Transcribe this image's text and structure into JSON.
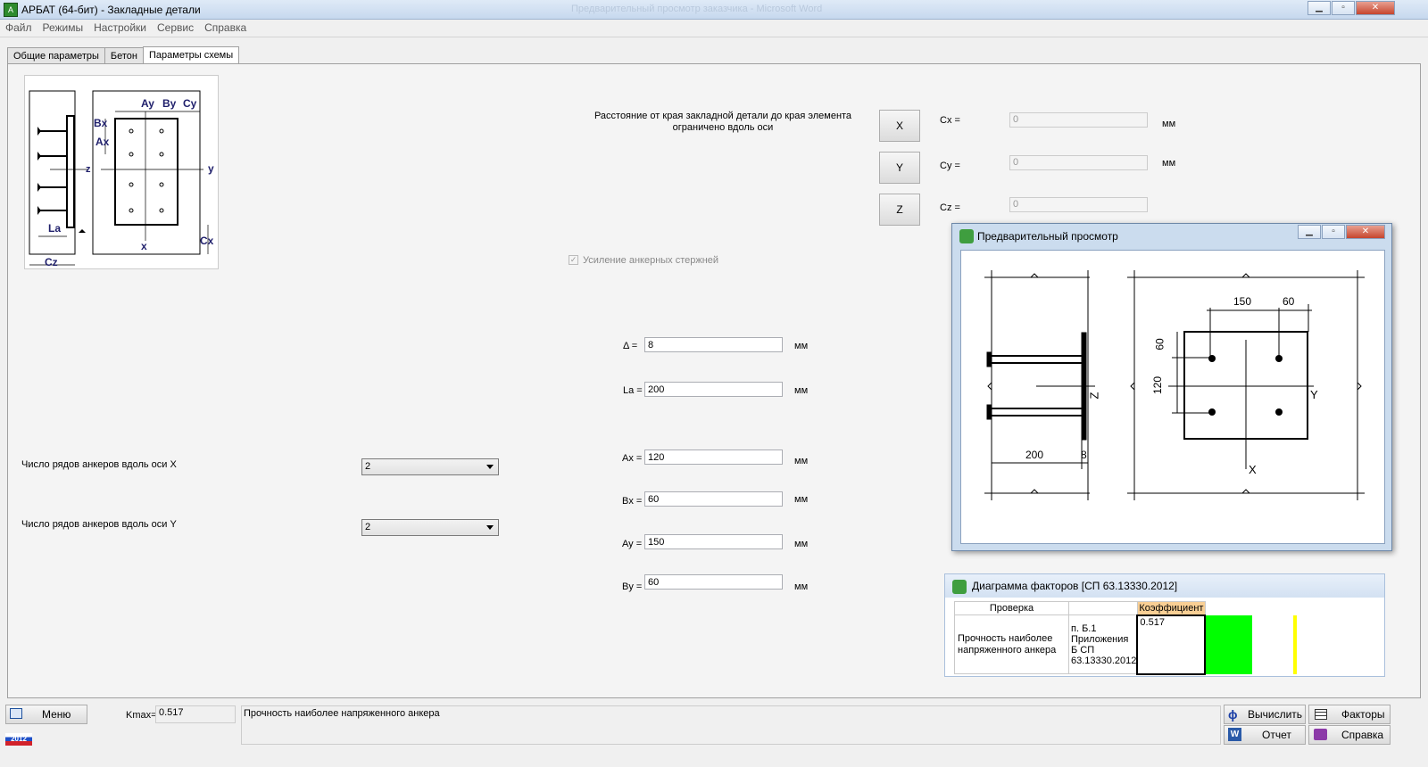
{
  "window": {
    "title": "АРБАТ (64-бит) - Закладные детали",
    "bg_title": "Предварительный просмотр заказчика - Microsoft Word"
  },
  "menu": [
    "Файл",
    "Режимы",
    "Настройки",
    "Сервис",
    "Справка"
  ],
  "tabs": [
    "Общие параметры",
    "Бетон",
    "Параметры схемы"
  ],
  "scheme_labels": {
    "ay": "Ay",
    "by": "By",
    "cy": "Cy",
    "bx": "Bx",
    "ax": "Ax",
    "y": "y",
    "z": "z",
    "x": "x",
    "la": "La",
    "cx": "Cx",
    "cz": "Cz"
  },
  "distance": {
    "label": "Расстояние от края закладной детали до края элемента ограничено вдоль оси",
    "buttons": [
      "X",
      "Y",
      "Z"
    ],
    "labels": [
      "Cx =",
      "Cy =",
      "Cz ="
    ],
    "values": [
      "0",
      "0",
      "0"
    ],
    "unit": "мм"
  },
  "reinforce": {
    "label": "Усиление анкерных стержней",
    "checked": true
  },
  "params": {
    "delta": {
      "label": "Δ =",
      "value": "8",
      "unit": "мм"
    },
    "la": {
      "label": "La =",
      "value": "200",
      "unit": "мм"
    },
    "ax": {
      "label": "Ax =",
      "value": "120",
      "unit": "мм"
    },
    "bx": {
      "label": "Bx =",
      "value": "60",
      "unit": "мм"
    },
    "ay": {
      "label": "Ay =",
      "value": "150",
      "unit": "мм"
    },
    "by": {
      "label": "By =",
      "value": "60",
      "unit": "мм"
    }
  },
  "rows_x": {
    "label": "Число рядов анкеров вдоль оси X",
    "value": "2"
  },
  "rows_y": {
    "label": "Число рядов анкеров вдоль оси Y",
    "value": "2"
  },
  "preview": {
    "title": "Предварительный просмотр",
    "dims": {
      "a": "150",
      "b": "60",
      "c": "60",
      "d": "120",
      "len": "200",
      "thk": "8"
    },
    "axes": {
      "y": "Y",
      "z": "Z",
      "x": "X"
    }
  },
  "factors": {
    "title": "Диаграмма факторов [СП 63.13330.2012]",
    "headers": [
      "Проверка",
      "",
      "Коэффициент"
    ],
    "row": {
      "check": "Прочность наиболее напряженного анкера",
      "ref": "п. Б.1 Приложения Б СП 63.13330.2012",
      "coef": "0.517"
    },
    "colors": {
      "bar": "#00ff00",
      "limit": "#ffff00",
      "header_accent": "#f9cf94"
    }
  },
  "bottom": {
    "menu_label": "Меню",
    "kmax_label": "Kmax=",
    "kmax_value": "0.517",
    "status": "Прочность наиболее напряженного анкера",
    "badge": "2012",
    "buttons": {
      "calc": "Вычислить",
      "factors": "Факторы",
      "report": "Отчет",
      "help": "Справка"
    }
  }
}
